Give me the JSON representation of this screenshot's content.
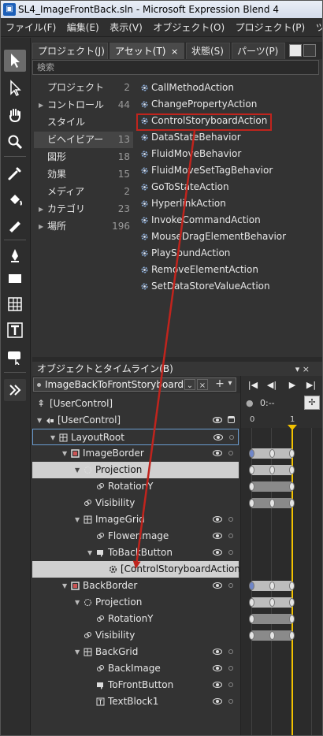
{
  "window": {
    "title": "SL4_ImageFrontBack.sln - Microsoft Expression Blend 4",
    "app_icon": "blend-icon"
  },
  "menu": [
    "ファイル(F)",
    "編集(E)",
    "表示(V)",
    "オブジェクト(O)",
    "プロジェクト(P)",
    "ツール("
  ],
  "toolbar": {
    "tools": [
      "selection-icon",
      "direct-selection-icon",
      "pan-icon",
      "zoom-icon",
      "eyedropper-icon",
      "paint-bucket-icon",
      "gradient-icon",
      "pen-icon",
      "rectangle-icon",
      "grid-icon",
      "text-icon",
      "control-icon",
      "more-assets-icon"
    ]
  },
  "panel_tabs": [
    "プロジェクト(J)",
    "アセット(T)",
    "状態(S)",
    "パーツ(P)"
  ],
  "panel_tab_close": "×",
  "search_placeholder": "検索",
  "categories": [
    {
      "label": "プロジェクト",
      "count": "2",
      "expand": ""
    },
    {
      "label": "コントロール",
      "count": "44",
      "expand": "▶"
    },
    {
      "label": "スタイル",
      "count": "",
      "expand": ""
    },
    {
      "label": "ビヘイビアー",
      "count": "13",
      "expand": ""
    },
    {
      "label": "図形",
      "count": "18",
      "expand": ""
    },
    {
      "label": "効果",
      "count": "15",
      "expand": ""
    },
    {
      "label": "メディア",
      "count": "2",
      "expand": ""
    },
    {
      "label": "カテゴリ",
      "count": "23",
      "expand": "▶"
    },
    {
      "label": "場所",
      "count": "196",
      "expand": "▶"
    }
  ],
  "behaviors": [
    "CallMethodAction",
    "ChangePropertyAction",
    "ControlStoryboardAction",
    "DataStateBehavior",
    "FluidMoveBehavior",
    "FluidMoveSetTagBehavior",
    "GoToStateAction",
    "HyperlinkAction",
    "InvokeCommandAction",
    "MouseDragElementBehavior",
    "PlaySoundAction",
    "RemoveElementAction",
    "SetDataStoreValueAction"
  ],
  "objects_panel": {
    "title": "オブジェクトとタイムライン(B)",
    "pin": "▾ ×",
    "storyboard": "ImageBackToFrontStoryboard",
    "user_control_scope": "[UserControl]",
    "playback": [
      "|◀",
      "◀|",
      "▶",
      "▶|"
    ],
    "time_readout": "0:--",
    "ticks": [
      "0",
      "1"
    ]
  },
  "tree": [
    {
      "label": "[UserControl]",
      "indent": 0,
      "arrow": "▼",
      "icon": "usercontrol-icon",
      "eye": true,
      "lock": false
    },
    {
      "label": "LayoutRoot",
      "indent": 1,
      "arrow": "▼",
      "icon": "grid-icon",
      "eye": true,
      "lock": true
    },
    {
      "label": "ImageBorder",
      "indent": 2,
      "arrow": "▼",
      "icon": "border-icon",
      "eye": true,
      "lock": true
    },
    {
      "label": "Projection",
      "indent": 3,
      "arrow": "▼",
      "icon": "projection-icon",
      "eye": false,
      "lock": false
    },
    {
      "label": "RotationY",
      "indent": 4,
      "arrow": "",
      "icon": "rotation-icon",
      "eye": false,
      "lock": false
    },
    {
      "label": "Visibility",
      "indent": 3,
      "arrow": "",
      "icon": "visibility-icon",
      "eye": false,
      "lock": false
    },
    {
      "label": "ImageGrid",
      "indent": 3,
      "arrow": "▼",
      "icon": "grid-icon",
      "eye": true,
      "lock": true
    },
    {
      "label": "FlowerImage",
      "indent": 4,
      "arrow": "",
      "icon": "image-icon",
      "eye": true,
      "lock": true
    },
    {
      "label": "ToBackButton",
      "indent": 4,
      "arrow": "▼",
      "icon": "button-icon",
      "eye": true,
      "lock": true
    },
    {
      "label": "[ControlStoryboardAction]",
      "indent": 5,
      "arrow": "",
      "icon": "behavior-icon",
      "eye": false,
      "lock": false
    },
    {
      "label": "BackBorder",
      "indent": 2,
      "arrow": "▼",
      "icon": "border-icon",
      "eye": true,
      "lock": true
    },
    {
      "label": "Projection",
      "indent": 3,
      "arrow": "▼",
      "icon": "projection-icon",
      "eye": false,
      "lock": false
    },
    {
      "label": "RotationY",
      "indent": 4,
      "arrow": "",
      "icon": "rotation-icon",
      "eye": false,
      "lock": false
    },
    {
      "label": "Visibility",
      "indent": 3,
      "arrow": "",
      "icon": "visibility-icon",
      "eye": false,
      "lock": false
    },
    {
      "label": "BackGrid",
      "indent": 3,
      "arrow": "▼",
      "icon": "grid-icon",
      "eye": true,
      "lock": true
    },
    {
      "label": "BackImage",
      "indent": 4,
      "arrow": "",
      "icon": "image-icon",
      "eye": true,
      "lock": true
    },
    {
      "label": "ToFrontButton",
      "indent": 4,
      "arrow": "",
      "icon": "button-icon",
      "eye": true,
      "lock": true
    },
    {
      "label": "TextBlock1",
      "indent": 4,
      "arrow": "",
      "icon": "textblock-icon",
      "eye": true,
      "lock": true
    }
  ],
  "colors": {
    "highlight_box": "#c0241d",
    "drag_arrow": "#c0241d",
    "playhead": "#f2c200",
    "keyframe_bar": "#bdbdbd"
  }
}
